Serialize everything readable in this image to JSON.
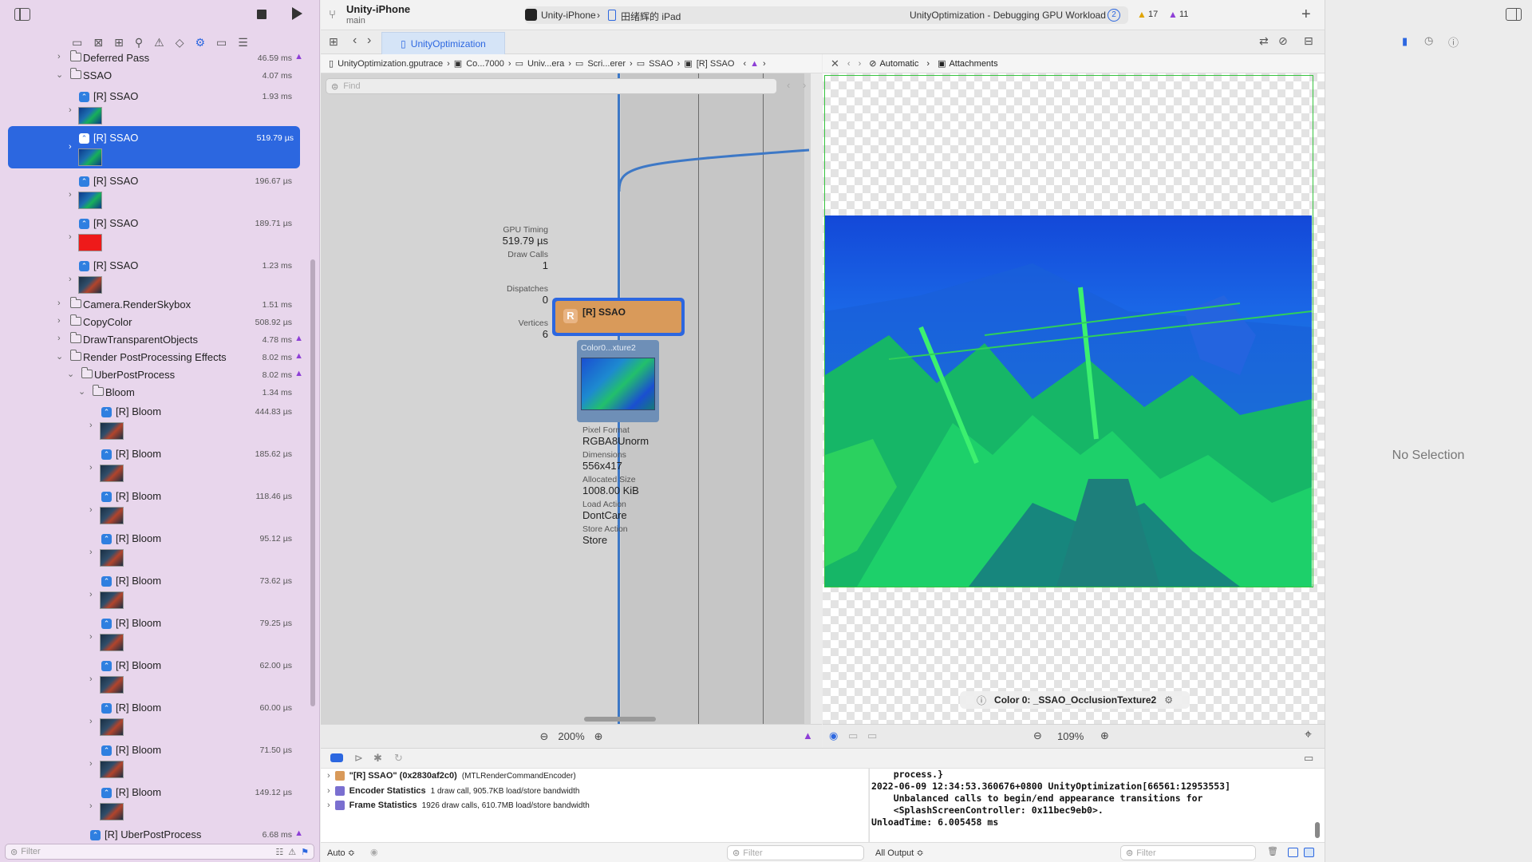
{
  "titlebar": {
    "project_name": "Unity-iPhone",
    "branch": "main",
    "scheme": "Unity-iPhone",
    "device": "田绪辉的 iPad",
    "status": "UnityOptimization - Debugging GPU Workload",
    "status_badge": "2",
    "warning_count": "17",
    "issue_count": "11"
  },
  "sidebar": {
    "filter_placeholder": "Filter",
    "rows": [
      {
        "label": "Deferred Pass",
        "time": "46.59 ms",
        "warn": "▲"
      },
      {
        "label": "SSAO",
        "time": "4.07 ms"
      },
      {
        "label": "[R] SSAO",
        "time": "1.93 ms"
      },
      {
        "label": "[R] SSAO",
        "time": "519.79 µs"
      },
      {
        "label": "[R] SSAO",
        "time": "196.67 µs"
      },
      {
        "label": "[R] SSAO",
        "time": "189.71 µs"
      },
      {
        "label": "[R] SSAO",
        "time": "1.23 ms"
      },
      {
        "label": "Camera.RenderSkybox",
        "time": "1.51 ms"
      },
      {
        "label": "CopyColor",
        "time": "508.92 µs"
      },
      {
        "label": "DrawTransparentObjects",
        "time": "4.78 ms",
        "warn": "▲"
      },
      {
        "label": "Render PostProcessing Effects",
        "time": "8.02 ms",
        "warn": "▲"
      },
      {
        "label": "UberPostProcess",
        "time": "8.02 ms",
        "warn": "▲"
      },
      {
        "label": "Bloom",
        "time": "1.34 ms"
      },
      {
        "label": "[R] Bloom",
        "time": "444.83 µs"
      },
      {
        "label": "[R] Bloom",
        "time": "185.62 µs"
      },
      {
        "label": "[R] Bloom",
        "time": "118.46 µs"
      },
      {
        "label": "[R] Bloom",
        "time": "95.12 µs"
      },
      {
        "label": "[R] Bloom",
        "time": "73.62 µs"
      },
      {
        "label": "[R] Bloom",
        "time": "79.25 µs"
      },
      {
        "label": "[R] Bloom",
        "time": "62.00 µs"
      },
      {
        "label": "[R] Bloom",
        "time": "60.00 µs"
      },
      {
        "label": "[R] Bloom",
        "time": "71.50 µs"
      },
      {
        "label": "[R] Bloom",
        "time": "149.12 µs"
      },
      {
        "label": "[R] UberPostProcess",
        "time": "6.68 ms",
        "warn": "▲"
      }
    ]
  },
  "editor": {
    "tab_label": "UnityOptimization",
    "jump": [
      "UnityOptimization.gputrace",
      "Co...7000",
      "Univ...era",
      "Scri...erer",
      "SSAO",
      "[R] SSAO"
    ],
    "find_placeholder": "Find",
    "zoom": "200%",
    "stats": {
      "gpu_timing_label": "GPU Timing",
      "gpu_timing_value": "519.79 µs",
      "draw_calls_label": "Draw Calls",
      "draw_calls_value": "1",
      "dispatches_label": "Dispatches",
      "dispatches_value": "0",
      "vertices_label": "Vertices",
      "vertices_value": "6"
    },
    "encoder_node": {
      "badge": "R",
      "label": "[R] SSAO"
    },
    "texture_node": {
      "label": "Color0...xture2"
    },
    "texture_info": [
      {
        "label": "Pixel Format",
        "value": "RGBA8Unorm"
      },
      {
        "label": "Dimensions",
        "value": "556x417"
      },
      {
        "label": "Allocated Size",
        "value": "1008.00 KiB"
      },
      {
        "label": "Load Action",
        "value": "DontCare"
      },
      {
        "label": "Store Action",
        "value": "Store"
      }
    ]
  },
  "viewer": {
    "automatic": "Automatic",
    "attachments": "Attachments",
    "caption": "Color 0: _SSAO_OcclusionTexture2",
    "zoom": "109%"
  },
  "inspector": {
    "no_selection": "No Selection"
  },
  "debug": {
    "vars": [
      {
        "name": "\"[R] SSAO\" (0x2830af2c0)",
        "detail": "(MTLRenderCommandEncoder)"
      },
      {
        "name": "Encoder Statistics",
        "detail": "1 draw call, 905.7KB load/store bandwidth"
      },
      {
        "name": "Frame Statistics",
        "detail": "1926 draw calls, 610.7MB load/store bandwidth"
      }
    ],
    "console": "    process.}\n2022-06-09 12:34:53.360676+0800 UnityOptimization[66561:12953553]\n    Unbalanced calls to begin/end appearance transitions for\n    <SplashScreenController: 0x11bec9eb0>.\nUnloadTime: 6.005458 ms",
    "auto_label": "Auto ≎",
    "vars_filter": "Filter",
    "output_label": "All Output ≎",
    "console_filter": "Filter"
  }
}
